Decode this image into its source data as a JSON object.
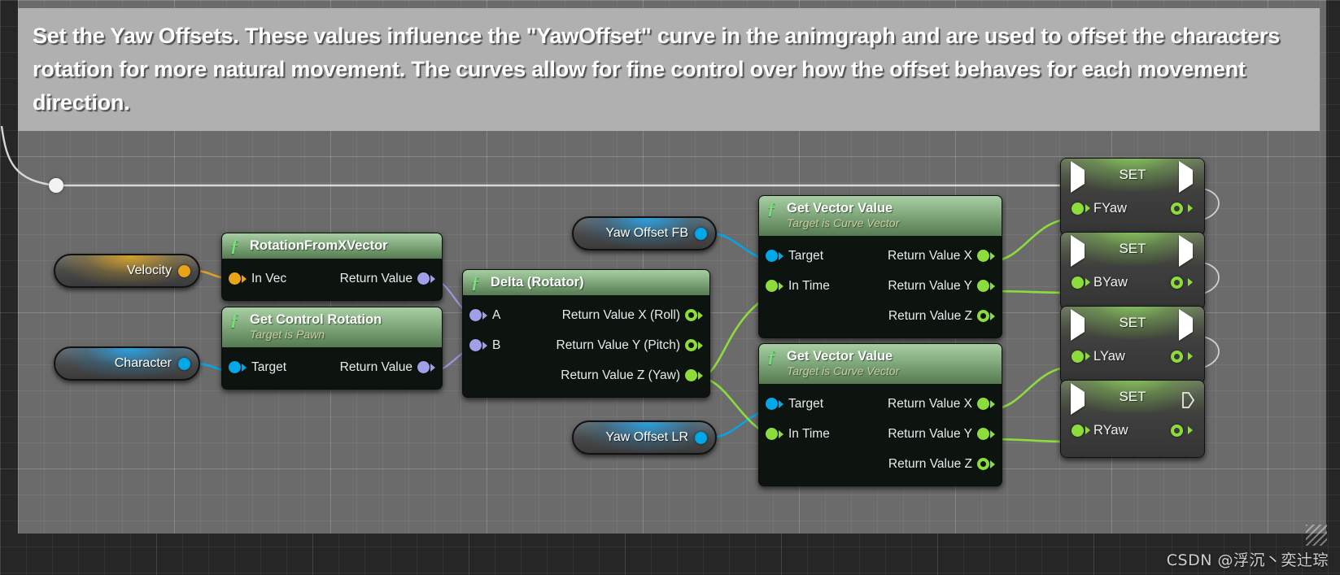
{
  "comment": {
    "text": "Set the Yaw Offsets. These values influence the \"YawOffset\" curve in the animgraph and are used to offset the characters rotation for more natural movement. The curves allow for fine control over how the offset behaves for each movement direction."
  },
  "colors": {
    "exec_white": "#ffffff",
    "vector_gold": "#e8a317",
    "object_blue": "#00a8e8",
    "rotator_purple": "#a0a0e8",
    "float_green": "#8cdd3c",
    "node_header_green": "#84ad80",
    "set_node_body": "#3d3d3d",
    "comment_bg": "#b0b0b0",
    "canvas_bg": "#6b6b6b"
  },
  "variables": [
    {
      "name": "Velocity",
      "pin_color": "#e8a317",
      "pin_type": "vector"
    },
    {
      "name": "Character",
      "pin_color": "#00a8e8",
      "pin_type": "object"
    },
    {
      "name": "Yaw Offset FB",
      "pin_color": "#00a8e8",
      "pin_type": "object"
    },
    {
      "name": "Yaw Offset LR",
      "pin_color": "#00a8e8",
      "pin_type": "object"
    }
  ],
  "nodes": {
    "rotation_from_xvector": {
      "title": "RotationFromXVector",
      "subtitle": "",
      "inputs": [
        {
          "label": "In Vec",
          "color": "#e8a317",
          "filled": true
        }
      ],
      "outputs": [
        {
          "label": "Return Value",
          "color": "#a0a0e8",
          "filled": true
        }
      ]
    },
    "get_control_rotation": {
      "title": "Get Control Rotation",
      "subtitle": "Target is Pawn",
      "inputs": [
        {
          "label": "Target",
          "color": "#00a8e8",
          "filled": true
        }
      ],
      "outputs": [
        {
          "label": "Return Value",
          "color": "#a0a0e8",
          "filled": true
        }
      ]
    },
    "delta_rotator": {
      "title": "Delta (Rotator)",
      "subtitle": "",
      "inputs": [
        {
          "label": "A",
          "color": "#a0a0e8",
          "filled": true
        },
        {
          "label": "B",
          "color": "#a0a0e8",
          "filled": true
        }
      ],
      "outputs": [
        {
          "label": "Return Value X (Roll)",
          "color": "#8cdd3c",
          "filled": false
        },
        {
          "label": "Return Value Y (Pitch)",
          "color": "#8cdd3c",
          "filled": false
        },
        {
          "label": "Return Value Z (Yaw)",
          "color": "#8cdd3c",
          "filled": true
        }
      ]
    },
    "get_vector_value_fb": {
      "title": "Get Vector Value",
      "subtitle": "Target is Curve Vector",
      "inputs": [
        {
          "label": "Target",
          "color": "#00a8e8",
          "filled": true
        },
        {
          "label": "In Time",
          "color": "#8cdd3c",
          "filled": true
        }
      ],
      "outputs": [
        {
          "label": "Return Value X",
          "color": "#8cdd3c",
          "filled": true
        },
        {
          "label": "Return Value Y",
          "color": "#8cdd3c",
          "filled": true
        },
        {
          "label": "Return Value Z",
          "color": "#8cdd3c",
          "filled": false
        }
      ]
    },
    "get_vector_value_lr": {
      "title": "Get Vector Value",
      "subtitle": "Target is Curve Vector",
      "inputs": [
        {
          "label": "Target",
          "color": "#00a8e8",
          "filled": true
        },
        {
          "label": "In Time",
          "color": "#8cdd3c",
          "filled": true
        }
      ],
      "outputs": [
        {
          "label": "Return Value X",
          "color": "#8cdd3c",
          "filled": true
        },
        {
          "label": "Return Value Y",
          "color": "#8cdd3c",
          "filled": true
        },
        {
          "label": "Return Value Z",
          "color": "#8cdd3c",
          "filled": false
        }
      ]
    }
  },
  "set_nodes": [
    {
      "title": "SET",
      "variable": "FYaw",
      "pin_color": "#8cdd3c",
      "exec_out_filled": true
    },
    {
      "title": "SET",
      "variable": "BYaw",
      "pin_color": "#8cdd3c",
      "exec_out_filled": true
    },
    {
      "title": "SET",
      "variable": "LYaw",
      "pin_color": "#8cdd3c",
      "exec_out_filled": true
    },
    {
      "title": "SET",
      "variable": "RYaw",
      "pin_color": "#8cdd3c",
      "exec_out_filled": false
    }
  ],
  "watermark": {
    "text": "CSDN @浮沉丶奕辻琮"
  }
}
